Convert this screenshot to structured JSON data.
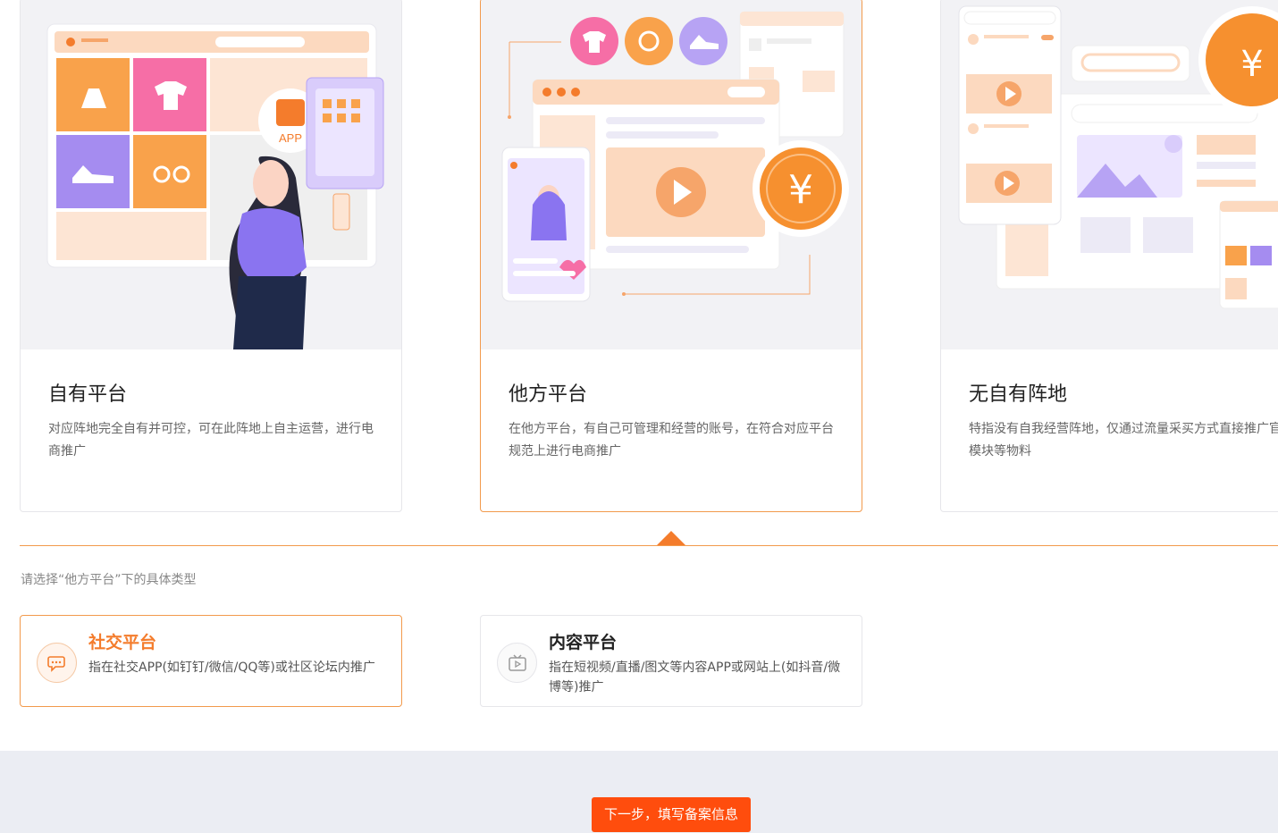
{
  "platform_cards": [
    {
      "title": "自有平台",
      "description": "对应阵地完全自有并可控，可在此阵地上自主运营，进行电商推广",
      "illustration_label": "APP"
    },
    {
      "title": "他方平台",
      "description": "在他方平台，有自己可管理和经营的账号，在符合对应平台规范上进行电商推广",
      "illustration_label": "¥"
    },
    {
      "title": "无自有阵地",
      "description": "特指没有自我经营阵地，仅通过流量采买方式直接推广官方页面/模块等物料",
      "illustration_label": "¥"
    }
  ],
  "selected_platform": "他方平台",
  "subtype_prompt": "请选择“他方平台”下的具体类型",
  "subtypes": [
    {
      "title": "社交平台",
      "description": "指在社交APP(如钉钉/微信/QQ等)或社区论坛内推广",
      "icon": "chat-icon"
    },
    {
      "title": "内容平台",
      "description": "指在短视频/直播/图文等内容APP或网站上(如抖音/微博等)推广",
      "icon": "tv-play-icon"
    }
  ],
  "selected_subtype": "社交平台",
  "next_button_label": "下一步，填写备案信息",
  "colors": {
    "accent": "#f47c2c",
    "button": "#ff4d0d",
    "footer_bg": "#ebedf3"
  }
}
